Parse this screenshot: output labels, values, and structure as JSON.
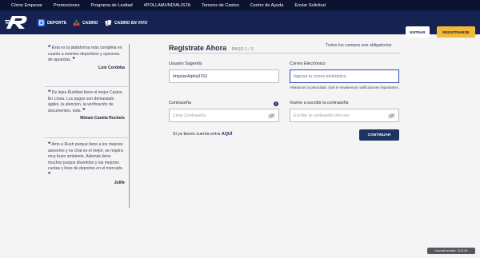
{
  "top_nav": {
    "links": [
      "Cómo Empezar",
      "Promociones",
      "Programa de Lealtad",
      "#POLLAMUNDIALISTA",
      "Torneos de Casino",
      "Centro de Ayuda",
      "Enviar Solicitud"
    ]
  },
  "header": {
    "categories": [
      "DEPORTE",
      "CASINO",
      "CASINO EN VIVO"
    ],
    "enter_label": "ENTRAR",
    "register_label": "REGISTRARSE",
    "colors": {
      "nav_bg": "#0c1330",
      "header_bg": "#162251",
      "register_bg": "#f2b93b",
      "accent": "#1d3461"
    }
  },
  "testimonials": [
    {
      "quote": "Esta es la plataforma más completa en cuanto a eventos deportivos y opciones de apuestas.",
      "author": "Luis Cordoba"
    },
    {
      "quote": "De lejos Rushbet tiene el mejor Casino En Linea. Los pagos son demasiado ágiles, la atención, la verificación de documentos, todo.",
      "author": "Miriam Camila Rochels"
    },
    {
      "quote": "Amo a Rush porque tiene a los mejores asesores y su chat es el mejor, se respira muy buen ambiente. Además tiene muchos juegos divertidos y las mejores cuotas y lives de deportes en el mercado.",
      "author": "Julife"
    }
  ],
  "form": {
    "title": "Registrate Ahora",
    "step": "PASO 1 / 3",
    "required_note": "Todos los campos son obligatorios",
    "username": {
      "label": "Usuario Sugerido",
      "value": "ImpulsoAlpha9763"
    },
    "email": {
      "label": "Correo Electrónico",
      "placeholder": "Ingresa tu correo electrónico",
      "help": "Velaramos tu privacidad. Solo te enviaremos notificaciones importantes."
    },
    "password": {
      "label": "Contraseña",
      "placeholder": "Crear Contraseña"
    },
    "password_confirm": {
      "label": "Vuelve a escribir la contraseña",
      "placeholder": "Escribe la contraseña otra vez"
    },
    "login_prompt": "Si ya tienes cuenta entra",
    "login_link": "AQUÍ",
    "continue_label": "CONTINUAR"
  },
  "clock": {
    "text": "Hora del servidor: 13:21:00"
  }
}
